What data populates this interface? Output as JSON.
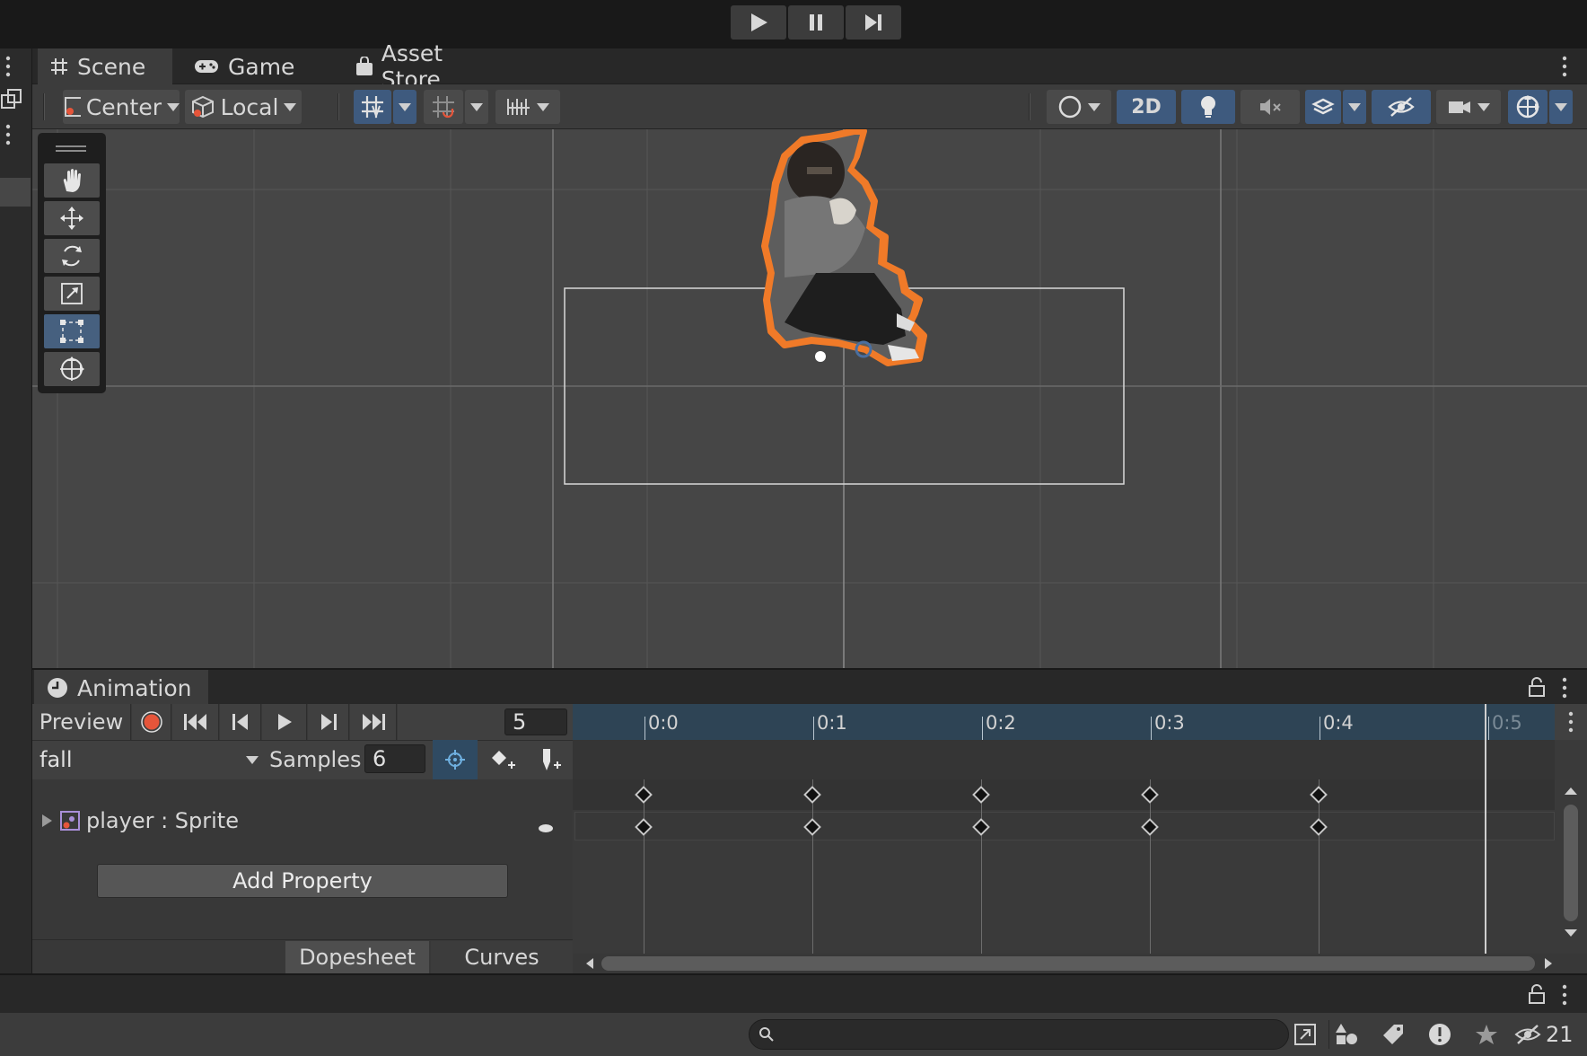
{
  "scene_window": {
    "tabs": [
      {
        "label": "Scene",
        "icon": "grid-hash-icon",
        "active": true
      },
      {
        "label": "Game",
        "icon": "gamepad-icon",
        "active": false
      },
      {
        "label": "Asset Store",
        "icon": "shopping-bag-icon",
        "active": false
      }
    ],
    "toolbar": {
      "pivot_label": "Center",
      "rotation_label": "Local",
      "view_2d_label": "2D"
    }
  },
  "tool_palette": [
    "hand-tool",
    "move-tool",
    "rotate-tool",
    "scale-tool",
    "rect-tool",
    "transform-tool"
  ],
  "animation_window": {
    "tab_label": "Animation",
    "preview_label": "Preview",
    "frame_value": "5",
    "clip_name": "fall",
    "samples_label": "Samples",
    "samples_value": "6",
    "property_label": "player : Sprite",
    "add_property_label": "Add Property",
    "dopesheet_label": "Dopesheet",
    "curves_label": "Curves",
    "timeline_ticks": [
      "0:0",
      "0:1",
      "0:2",
      "0:3",
      "0:4",
      "0:5"
    ],
    "keyframe_times": [
      "0:0",
      "0:1",
      "0:2",
      "0:3",
      "0:4"
    ]
  },
  "console": {
    "search_placeholder": "",
    "hidden_count": "21"
  },
  "colors": {
    "accent_blue": "#3e5a7e",
    "record_red": "#e5553a",
    "selection_orange": "#f07a28"
  }
}
